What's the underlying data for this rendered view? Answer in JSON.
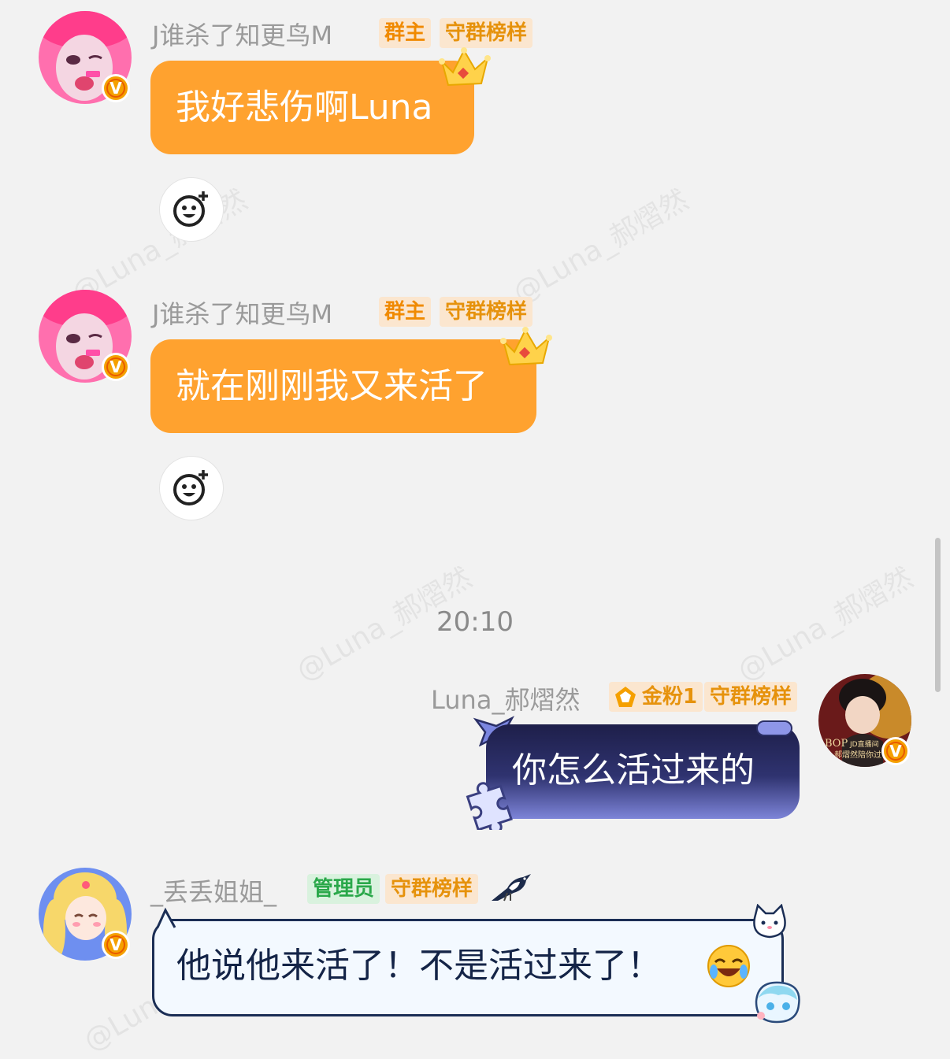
{
  "watermark": "@Luna_郝熠然",
  "messages": [
    {
      "sender": "J谁杀了知更鸟M",
      "tags": [
        "群主",
        "守群榜样"
      ],
      "text": "我好悲伤啊Luna",
      "avatar_badge": "V"
    },
    {
      "sender": "J谁杀了知更鸟M",
      "tags": [
        "群主",
        "守群榜样"
      ],
      "text": "就在刚刚我又来活了",
      "avatar_badge": "V"
    }
  ],
  "timestamp": "20:10",
  "self_message": {
    "sender": "Luna_郝熠然",
    "fan_tag": "金粉1",
    "guard_tag": "守群榜样",
    "text": "你怎么活过来的",
    "avatar_badge": "V",
    "avatar_caption": "BOP|JD直播间 郝熠然陪你过"
  },
  "last_message": {
    "sender": "_丢丢姐姐_",
    "tags": [
      "管理员",
      "守群榜样"
    ],
    "text": "他说他来活了！不是活过来了！",
    "avatar_badge": "V"
  },
  "icons": [
    "add-reaction-icon",
    "crown-icon",
    "v-verified-icon",
    "magpie-icon",
    "laughing-emoji-icon"
  ],
  "colors": {
    "orange_bubble": "#ffa22f",
    "dark_bubble": "#1e1f4a",
    "tag_orange": "#f08a00",
    "tag_green": "#2aa84a",
    "background": "#f2f2f2"
  }
}
